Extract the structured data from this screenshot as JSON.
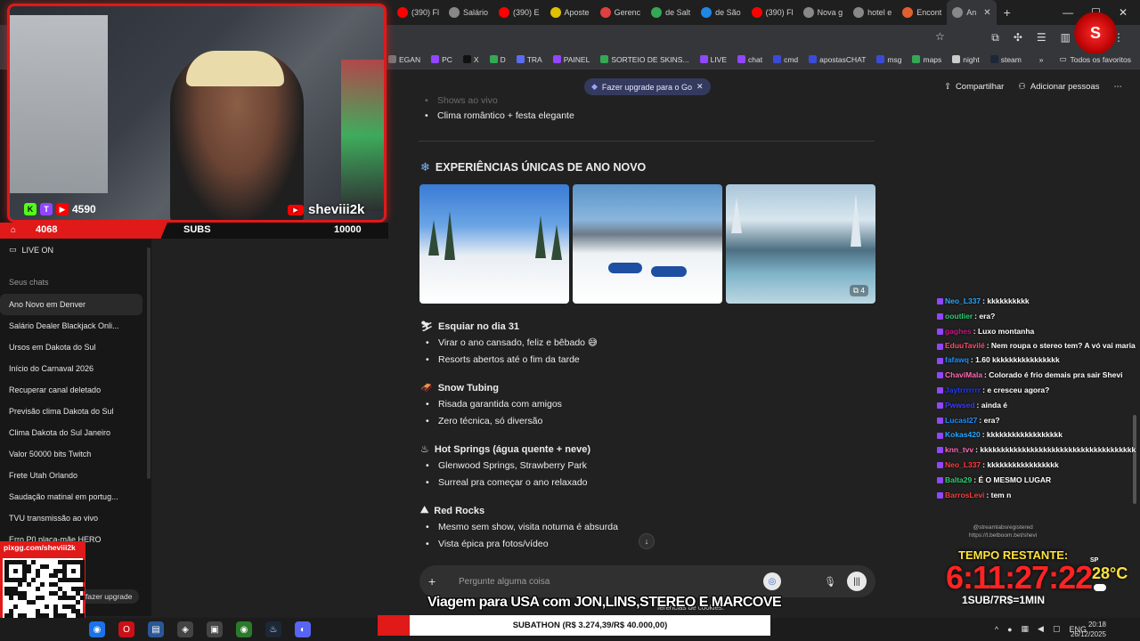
{
  "browser": {
    "tabs": [
      {
        "label": "(390) Fl",
        "color": "#ff0000"
      },
      {
        "label": "Salário",
        "color": "#888888"
      },
      {
        "label": "(390) E",
        "color": "#ff0000"
      },
      {
        "label": "Aposte",
        "color": "#e0c000"
      },
      {
        "label": "Gerenc",
        "color": "#e04040"
      },
      {
        "label": "de Salt",
        "color": "#34a853"
      },
      {
        "label": "de São",
        "color": "#1e88e5"
      },
      {
        "label": "(390) Fl",
        "color": "#ff0000"
      },
      {
        "label": "Nova g",
        "color": "#888888"
      },
      {
        "label": "hotel e",
        "color": "#888888"
      },
      {
        "label": "Encont",
        "color": "#e06030"
      },
      {
        "label": "An",
        "color": "#888888"
      }
    ],
    "new_tab": "+",
    "profile_initial": "S",
    "bookmarks": [
      {
        "label": "EGAN",
        "color": "#777777"
      },
      {
        "label": "PC",
        "color": "#9146ff"
      },
      {
        "label": "X",
        "color": "#111111"
      },
      {
        "label": "D",
        "color": "#34a853"
      },
      {
        "label": "TRA",
        "color": "#5b6cf0"
      },
      {
        "label": "PAINEL",
        "color": "#9146ff"
      },
      {
        "label": "SORTEIO DE SKINS...",
        "color": "#34a853"
      },
      {
        "label": "LIVE",
        "color": "#9146ff"
      },
      {
        "label": "chat",
        "color": "#9146ff"
      },
      {
        "label": "cmd",
        "color": "#3b4bd8"
      },
      {
        "label": "apostasCHAT",
        "color": "#3b4bd8"
      },
      {
        "label": "msg",
        "color": "#3b4bd8"
      },
      {
        "label": "maps",
        "color": "#34a853"
      },
      {
        "label": "night",
        "color": "#cccccc"
      },
      {
        "label": "steam",
        "color": "#1b2838"
      }
    ],
    "bookmarks_more": "»",
    "all_favorites": "Todos os favoritos"
  },
  "sidebar": {
    "live_on": "LIVE ON",
    "section_label": "Seus chats",
    "chats": [
      "Ano Novo em Denver",
      "Salário Dealer Blackjack Onli...",
      "Ursos em Dakota do Sul",
      "Início do Carnaval 2026",
      "Recuperar canal deletado",
      "Previsão clima Dakota do Sul",
      "Clima Dakota do Sul Janeiro",
      "Valor 50000 bits Twitch",
      "Frete Utah Orlando",
      "Saudação matinal em portug...",
      "TVU transmissão ao vivo",
      "Erro P0 placa-mãe HERO"
    ],
    "upgrade_pill": "fazer upgrade"
  },
  "header": {
    "upgrade_banner": "Fazer upgrade para o Go",
    "share": "Compartilhar",
    "add_people": "Adicionar pessoas",
    "more": "⋯"
  },
  "conversation": {
    "prev_bullets": [
      "Shows ao vivo",
      "Clima romântico + festa elegante"
    ],
    "section_title": "EXPERIÊNCIAS ÚNICAS DE ANO NOVO",
    "image_count": "4",
    "groups": [
      {
        "icon": "⛷",
        "title": "Esquiar no dia 31",
        "bullets": [
          "Virar o ano cansado, feliz e bêbado 😅",
          "Resorts abertos até o fim da tarde"
        ]
      },
      {
        "icon": "🛷",
        "title": "Snow Tubing",
        "bullets": [
          "Risada garantida com amigos",
          "Zero técnica, só diversão"
        ]
      },
      {
        "icon": "♨",
        "title": "Hot Springs (água quente + neve)",
        "bullets": [
          "Glenwood Springs, Strawberry Park",
          "Surreal pra começar o ano relaxado"
        ]
      },
      {
        "icon": "⛰",
        "title": "Red Rocks",
        "bullets": [
          "Mesmo sem show, visita noturna é absurda",
          "Vista épica pra fotos/vídeo"
        ]
      }
    ],
    "composer_placeholder": "Pergunte alguma coisa",
    "footnote": "ferências de cookies."
  },
  "stream": {
    "kick_count": "4590",
    "channel": "sheviii2k",
    "subs_left": "4068",
    "subs_label": "SUBS",
    "subs_goal": "10000",
    "qr_label": "pixgg.com/sheviii2k",
    "chat": [
      {
        "user": "Neo_L337",
        "text": "kkkkkkkkkk",
        "color": "#2aa7ff"
      },
      {
        "user": "ooutlier",
        "text": "era?",
        "color": "#2ecc71"
      },
      {
        "user": "gaghes",
        "text": "Luxo montanha",
        "color": "#c71585"
      },
      {
        "user": "EduuTavilé",
        "text": "Nem roupa o stereo tem? A vó vai maria",
        "color": "#ff4d6d",
        "wrap": true
      },
      {
        "user": "fafawq",
        "text": "1.60 kkkkkkkkkkkkkkkk",
        "color": "#1e90ff"
      },
      {
        "user": "ChaviMala",
        "text": "Colorado é frio demais pra sair Shevi",
        "color": "#ff69b4"
      },
      {
        "user": "Jaytrrrrrrr",
        "text": "e cresceu agora?",
        "color": "#1e3cff"
      },
      {
        "user": "Pwwsed",
        "text": "ainda é",
        "color": "#3b3bff"
      },
      {
        "user": "Lucasl27",
        "text": "era?",
        "color": "#1e90ff"
      },
      {
        "user": "Kokas420",
        "text": "kkkkkkkkkkkkkkkkkk",
        "color": "#2aa7ff"
      },
      {
        "user": "knn_tvv",
        "text": "kkkkkkkkkkkkkkkkkkkkkkkkkkkkkkkkkkkkk",
        "color": "#ff69b4"
      },
      {
        "user": "Neo_L337",
        "text": "kkkkkkkkkkkkkkkkk",
        "color": "#ff3b3b"
      },
      {
        "user": "Balta29",
        "text": "É O MESMO LUGAR",
        "color": "#2ecc71"
      },
      {
        "user": "BarrosLevi",
        "text": "tem n",
        "color": "#ff3b3b"
      }
    ],
    "chat_link_line1": "@streamlabsregistered",
    "chat_link_line2": "https://t.betboom.bet/shevi",
    "timer_label": "TEMPO RESTANTE:",
    "timer_value": "6:11:27:22",
    "timer_rate": "1SUB/7R$=1MIN",
    "weather_city": "SP",
    "weather_temp": "28°C",
    "caption": "Viagem para USA com JON,LINS,STEREO E MARCOVE",
    "subathon": "SUBATHON (R$ 3.274,39/R$ 40.000,00)"
  },
  "taskbar": {
    "lang": "ENG",
    "time": "20:18",
    "date": "26/12/2025"
  }
}
